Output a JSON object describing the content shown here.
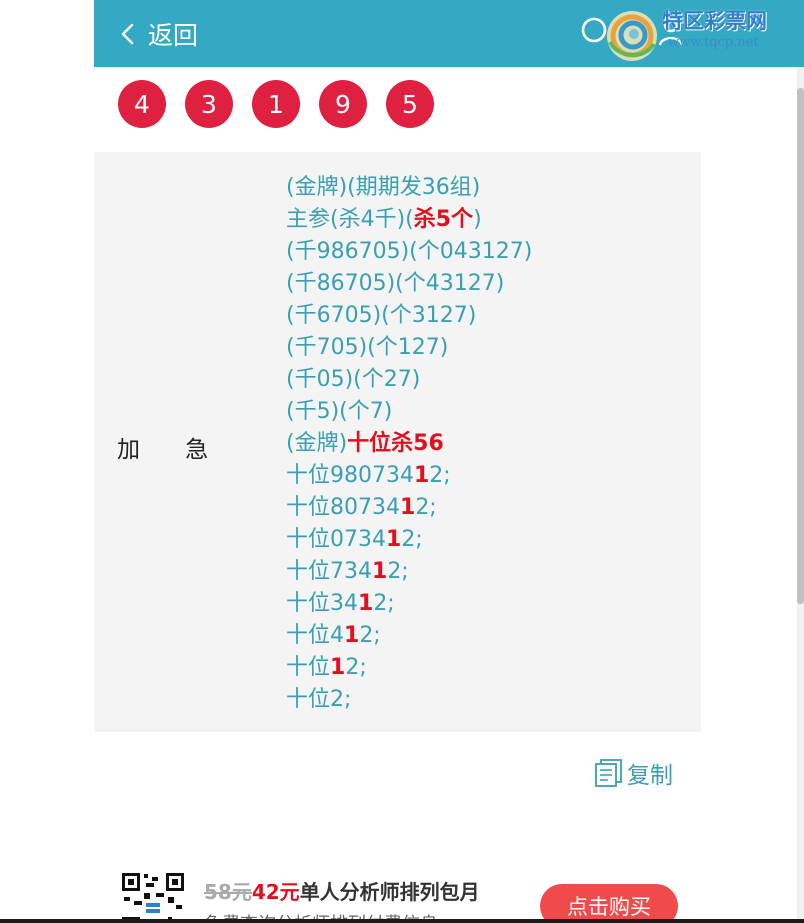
{
  "header": {
    "back_label": "返回",
    "bg_color": "#33a9c3"
  },
  "watermark": {
    "brand": "特区彩票网",
    "url": "www.tqcp.net"
  },
  "balls": [
    "4",
    "3",
    "1",
    "9",
    "5"
  ],
  "panel": {
    "label": "加 急",
    "lines": [
      [
        {
          "t": "(金牌)(期期发36组)"
        }
      ],
      [
        {
          "t": "主参(杀4千)("
        },
        {
          "t": "杀5个",
          "red": true
        },
        {
          "t": ")"
        }
      ],
      [
        {
          "t": "(千986705)(个043127)"
        }
      ],
      [
        {
          "t": "(千86705)(个43127)"
        }
      ],
      [
        {
          "t": "(千6705)(个3127)"
        }
      ],
      [
        {
          "t": "(千705)(个127)"
        }
      ],
      [
        {
          "t": "(千05)(个27)"
        }
      ],
      [
        {
          "t": "(千5)(个7)"
        }
      ],
      [
        {
          "t": "(金牌)"
        },
        {
          "t": "十位杀56",
          "red": true
        }
      ],
      [
        {
          "t": "十位980734"
        },
        {
          "t": "1",
          "red": true
        },
        {
          "t": "2;"
        }
      ],
      [
        {
          "t": "十位80734"
        },
        {
          "t": "1",
          "red": true
        },
        {
          "t": "2;"
        }
      ],
      [
        {
          "t": "十位0734"
        },
        {
          "t": "1",
          "red": true
        },
        {
          "t": "2;"
        }
      ],
      [
        {
          "t": "十位734"
        },
        {
          "t": "1",
          "red": true
        },
        {
          "t": "2;"
        }
      ],
      [
        {
          "t": "十位34"
        },
        {
          "t": "1",
          "red": true
        },
        {
          "t": "2;"
        }
      ],
      [
        {
          "t": "十位4"
        },
        {
          "t": "1",
          "red": true
        },
        {
          "t": "2;"
        }
      ],
      [
        {
          "t": "十位"
        },
        {
          "t": "1",
          "red": true
        },
        {
          "t": "2;"
        }
      ],
      [
        {
          "t": "十位2;"
        }
      ]
    ]
  },
  "copy": {
    "label": "复制"
  },
  "promo": {
    "price_old": "58元",
    "price_new": "42元",
    "title": "单人分析师排列包月",
    "subtitle": "免费查询分析师排列付费信息",
    "buy_label": "点击购买"
  },
  "icons": {
    "back": "chevron-left-icon",
    "search": "search-icon",
    "user": "user-icon",
    "copy": "copy-icon",
    "qr": "qr-code-icon",
    "logo": "swirl-logo-icon"
  },
  "colors": {
    "ball": "#df2041",
    "text_teal": "#3a9fb3",
    "highlight_red": "#e0101e",
    "button_red": "#f04a4a"
  }
}
